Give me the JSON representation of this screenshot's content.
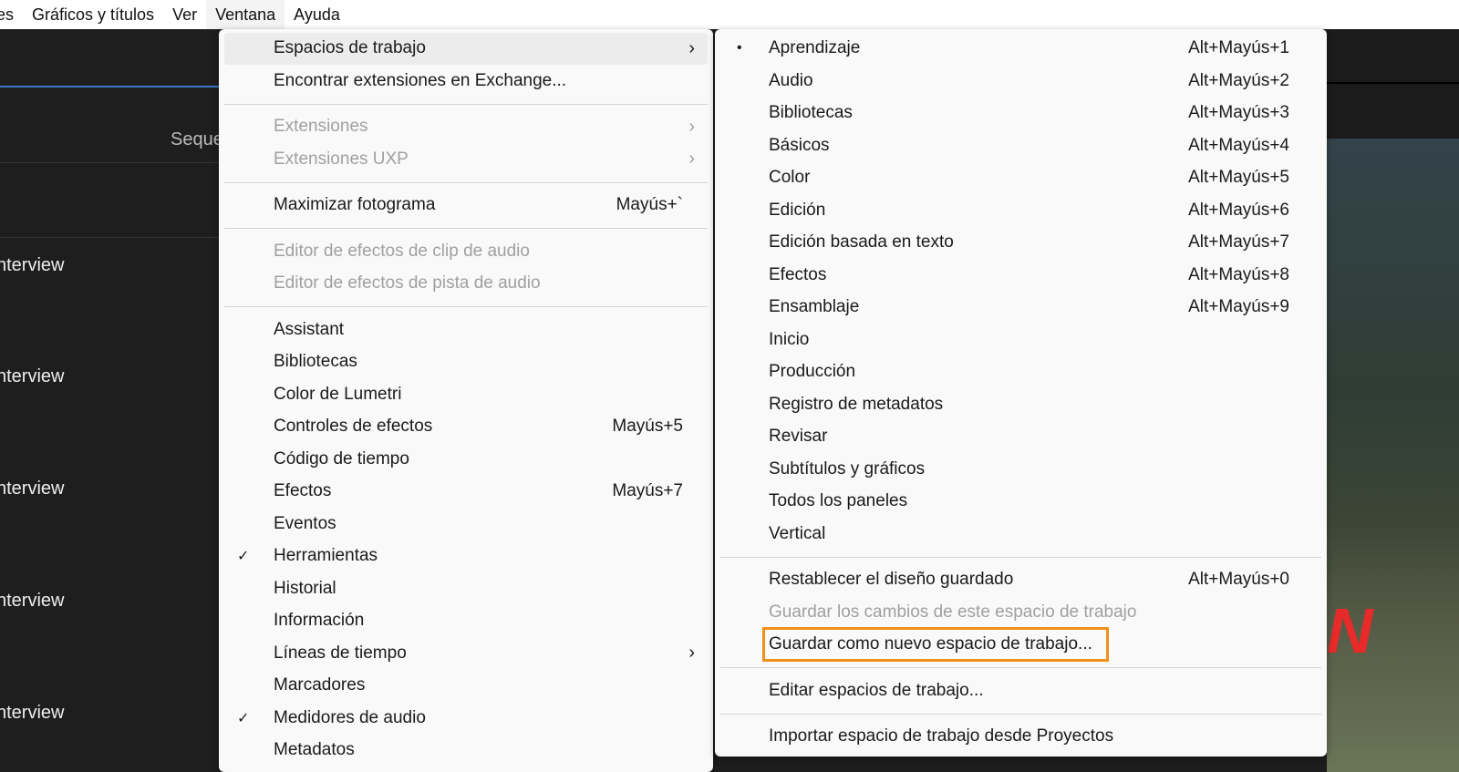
{
  "menubar": {
    "items": [
      "es",
      "Gráficos y títulos",
      "Ver",
      "Ventana",
      "Ayuda"
    ]
  },
  "background": {
    "sequence_label": "Seque",
    "clips": [
      "nterview",
      "nterview",
      "nterview",
      "nterview",
      "nterview"
    ]
  },
  "window_menu": {
    "workspaces": "Espacios de trabajo",
    "find_extensions": "Encontrar extensiones en Exchange...",
    "extensions": "Extensiones",
    "extensions_uxp": "Extensiones UXP",
    "maximize": "Maximizar fotograma",
    "maximize_sc": "Mayús+`",
    "audio_clip_fx": "Editor de efectos de clip de audio",
    "audio_track_fx": "Editor de efectos de pista de audio",
    "panels": [
      {
        "label": "Assistant",
        "sc": ""
      },
      {
        "label": "Bibliotecas",
        "sc": ""
      },
      {
        "label": "Color de Lumetri",
        "sc": ""
      },
      {
        "label": "Controles de efectos",
        "sc": "Mayús+5"
      },
      {
        "label": "Código de tiempo",
        "sc": ""
      },
      {
        "label": "Efectos",
        "sc": "Mayús+7"
      },
      {
        "label": "Eventos",
        "sc": ""
      },
      {
        "label": "Herramientas",
        "sc": "",
        "checked": true
      },
      {
        "label": "Historial",
        "sc": ""
      },
      {
        "label": "Información",
        "sc": ""
      },
      {
        "label": "Líneas de tiempo",
        "sc": "",
        "submenu": true
      },
      {
        "label": "Marcadores",
        "sc": ""
      },
      {
        "label": "Medidores de audio",
        "sc": "",
        "checked": true
      },
      {
        "label": "Metadatos",
        "sc": ""
      }
    ]
  },
  "workspaces_menu": {
    "items": [
      {
        "label": "Aprendizaje",
        "sc": "Alt+Mayús+1",
        "active": true
      },
      {
        "label": "Audio",
        "sc": "Alt+Mayús+2"
      },
      {
        "label": "Bibliotecas",
        "sc": "Alt+Mayús+3"
      },
      {
        "label": "Básicos",
        "sc": "Alt+Mayús+4"
      },
      {
        "label": "Color",
        "sc": "Alt+Mayús+5"
      },
      {
        "label": "Edición",
        "sc": "Alt+Mayús+6"
      },
      {
        "label": "Edición basada en texto",
        "sc": "Alt+Mayús+7"
      },
      {
        "label": "Efectos",
        "sc": "Alt+Mayús+8"
      },
      {
        "label": "Ensamblaje",
        "sc": "Alt+Mayús+9"
      },
      {
        "label": "Inicio",
        "sc": ""
      },
      {
        "label": "Producción",
        "sc": ""
      },
      {
        "label": "Registro de metadatos",
        "sc": ""
      },
      {
        "label": "Revisar",
        "sc": ""
      },
      {
        "label": "Subtítulos y gráficos",
        "sc": ""
      },
      {
        "label": "Todos los paneles",
        "sc": ""
      },
      {
        "label": "Vertical",
        "sc": ""
      }
    ],
    "reset": "Restablecer el diseño guardado",
    "reset_sc": "Alt+Mayús+0",
    "save_changes": "Guardar los cambios de este espacio de trabajo",
    "save_new": "Guardar como nuevo espacio de trabajo...",
    "edit": "Editar espacios de trabajo...",
    "import": "Importar espacio de trabajo desde Proyectos"
  },
  "colors": {
    "highlight_box": "#f0901a"
  }
}
